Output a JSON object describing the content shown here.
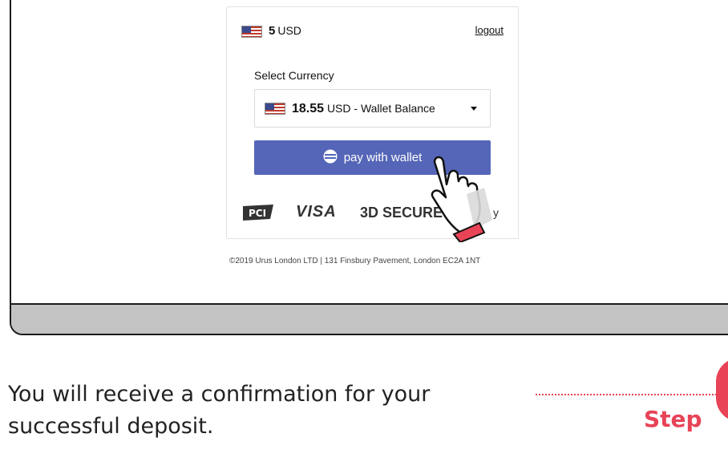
{
  "card": {
    "balance_amount": "5",
    "balance_currency": "USD",
    "logout_label": "logout",
    "select_label": "Select Currency",
    "selected_amount": "18.55",
    "selected_suffix": "USD - Wallet Balance",
    "pay_button_label": "pay with wallet",
    "logos": {
      "pci": "PCI",
      "visa": "VISA",
      "secure": "3D SECURE",
      "fourth": "y"
    }
  },
  "footer": "©2019 Urus London LTD | 131 Finsbury Pavement, London EC2A 1NT",
  "caption": "You will receive a confirmation for your successful deposit.",
  "step_label": "Step",
  "colors": {
    "accent_button": "#5566b8",
    "step_red": "#e84357",
    "bezel": "#c3c3c3"
  },
  "icons": [
    "us-flag-icon",
    "wallet-icon",
    "caret-down-icon",
    "hand-pointer-icon",
    "pci-logo-icon"
  ]
}
